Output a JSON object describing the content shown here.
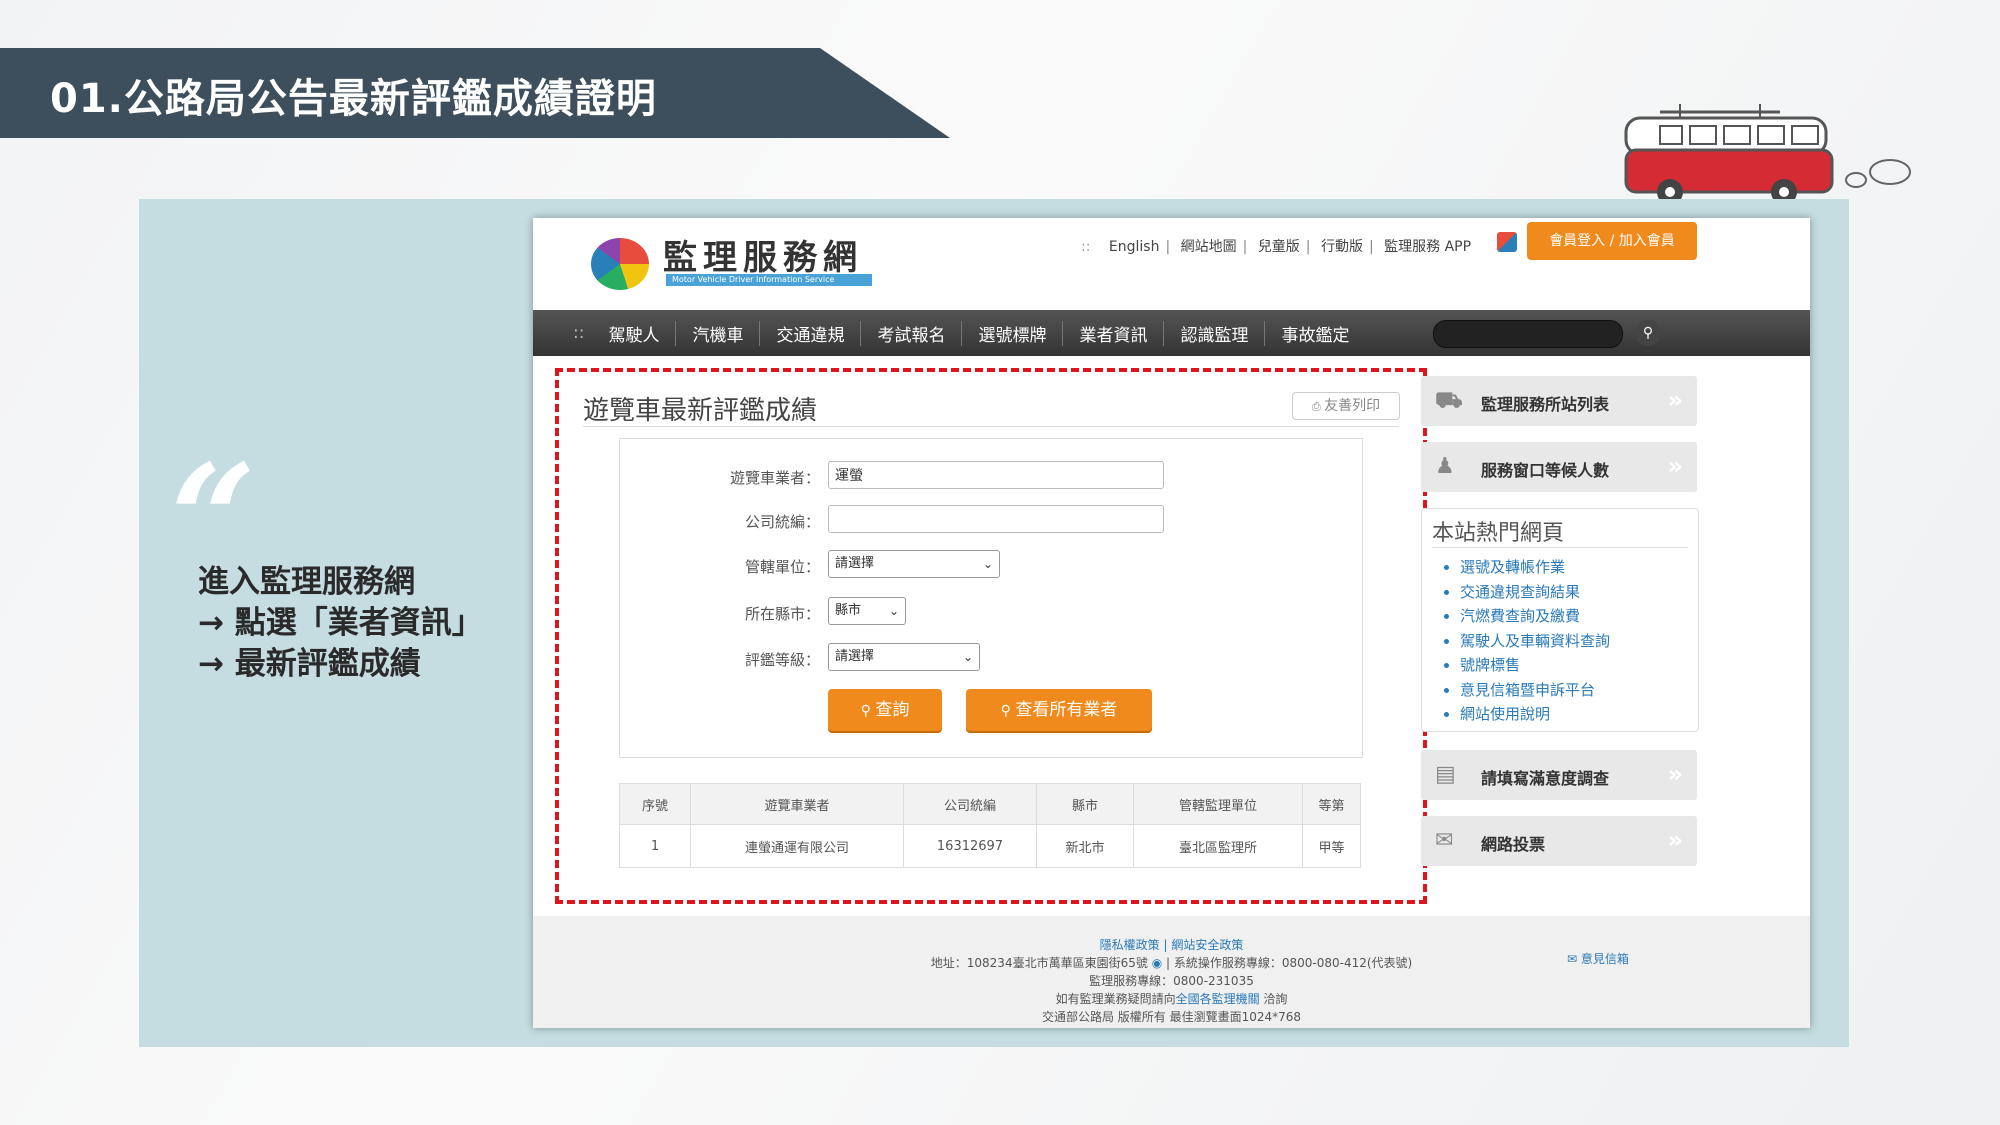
{
  "slide": {
    "title": "01.公路局公告最新評鑑成績證明",
    "quote_mark": "“",
    "steps": [
      "進入監理服務網",
      "→ 點選「業者資訊」",
      "→ 最新評鑑成績"
    ]
  },
  "site": {
    "logo_title": "監理服務網",
    "logo_subtitle": "Motor Vehicle Driver Information Service",
    "top_links": [
      "English",
      "網站地圖",
      "兒童版",
      "行動版",
      "監理服務 APP"
    ],
    "top_links_prefix": "::",
    "member_button": "會員登入 / 加入會員",
    "nav": {
      "prefix": "::",
      "items": [
        "駕駛人",
        "汽機車",
        "交通違規",
        "考試報名",
        "選號標牌",
        "業者資訊",
        "認識監理",
        "事故鑑定"
      ],
      "search_icon": "search-icon"
    },
    "page_title": "遊覽車最新評鑑成績",
    "print_button": "友善列印",
    "form": {
      "operator_label": "遊覽車業者：",
      "operator_value": "運螢",
      "tax_id_label": "公司統編：",
      "tax_id_value": "",
      "agency_label": "管轄單位：",
      "agency_value": "請選擇",
      "city_label": "所在縣市：",
      "city_value": "縣市",
      "grade_label": "評鑑等級：",
      "grade_value": "請選擇",
      "query_button": "查詢",
      "all_button": "查看所有業者"
    },
    "table": {
      "headers": [
        "序號",
        "遊覽車業者",
        "公司統編",
        "縣市",
        "管轄監理單位",
        "等第"
      ],
      "rows": [
        [
          "1",
          "連螢通運有限公司",
          "16312697",
          "新北市",
          "臺北區監理所",
          "甲等"
        ]
      ]
    },
    "sidebar": {
      "station_list": "監理服務所站列表",
      "waiting_count": "服務窗口等候人數",
      "hot_title": "本站熱門網頁",
      "hot_links": [
        "選號及轉帳作業",
        "交通違規查詢結果",
        "汽燃費查詢及繳費",
        "駕駛人及車輛資料查詢",
        "號牌標售",
        "意見信箱暨申訴平台",
        "網站使用說明"
      ],
      "survey": "請填寫滿意度調查",
      "vote": "網路投票"
    },
    "footer": {
      "policy_links": "隱私權政策 | 網站安全政策",
      "address": "地址：108234臺北市萬華區東園街65號",
      "hotline": "系統操作服務專線：0800-080-412(代表號)",
      "service_line": "監理服務專線：0800-231035",
      "inquiry_prefix": "如有監理業務疑問請向",
      "inquiry_link": "全國各監理機關",
      "inquiry_suffix": " 洽詢",
      "copyright": "交通部公路局 版權所有    最佳瀏覽畫面1024*768",
      "feedback": "意見信箱"
    }
  },
  "colors": {
    "banner": "#3d4f5c",
    "panel": "#c5dde1",
    "accent_orange": "#f08a1d",
    "highlight_red": "#e0141d",
    "link_blue": "#2a7ab8"
  }
}
